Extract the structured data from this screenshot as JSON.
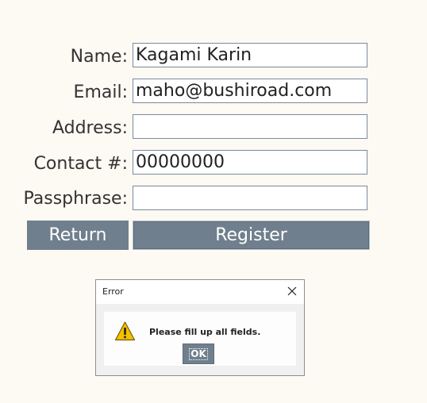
{
  "form": {
    "name_label": "Name:",
    "name_value": "Kagami Karin",
    "email_label": "Email:",
    "email_value": "maho@bushiroad.com",
    "address_label": "Address:",
    "address_value": "",
    "contact_label": "Contact #:",
    "contact_value": "00000000",
    "passphrase_label": "Passphrase:",
    "passphrase_value": ""
  },
  "buttons": {
    "return_label": "Return",
    "register_label": "Register"
  },
  "dialog": {
    "title": "Error",
    "message": "Please fill up all fields.",
    "ok_label": "OK",
    "icon": "warning-icon",
    "close_icon": "close-icon"
  },
  "colors": {
    "background": "#fdf9f3",
    "button": "#707f8d",
    "input_border": "#7a8a9e",
    "warning": "#f2c200"
  }
}
